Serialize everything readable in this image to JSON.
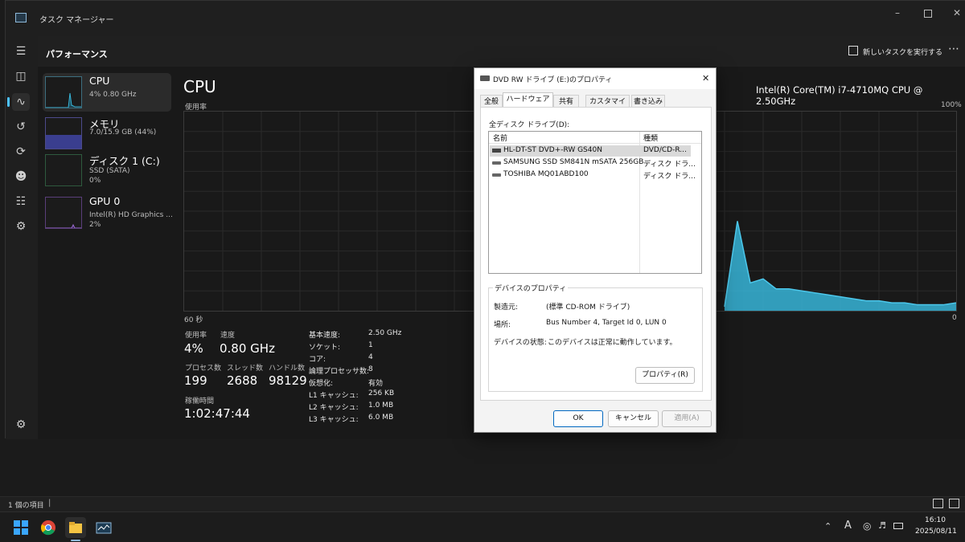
{
  "window": {
    "title": "タスク マネージャー",
    "page_title": "パフォーマンス",
    "run_task_label": "新しいタスクを実行する"
  },
  "sidebar": {
    "items": [
      {
        "title": "CPU",
        "sub1": "4% 0.80 GHz",
        "sub2": ""
      },
      {
        "title": "メモリ",
        "sub1": "7.0/15.9 GB (44%)",
        "sub2": ""
      },
      {
        "title": "ディスク 1 (C:)",
        "sub1": "SSD (SATA)",
        "sub2": "0%"
      },
      {
        "title": "GPU 0",
        "sub1": "Intel(R) HD Graphics ...",
        "sub2": "2%"
      }
    ]
  },
  "cpu": {
    "heading": "CPU",
    "model": "Intel(R) Core(TM) i7-4710MQ CPU @ 2.50GHz",
    "usage_label": "使用率",
    "max_label": "100%",
    "time_label": "60 秒",
    "zero_label": "0",
    "stats": {
      "usage_label": "使用率",
      "usage_value": "4%",
      "speed_label": "速度",
      "speed_value": "0.80 GHz",
      "proc_label": "プロセス数",
      "proc_value": "199",
      "thread_label": "スレッド数",
      "thread_value": "2688",
      "handle_label": "ハンドル数",
      "handle_value": "98129",
      "uptime_label": "稼働時間",
      "uptime_value": "1:02:47:44"
    },
    "specs": [
      {
        "label": "基本速度:",
        "value": "2.50 GHz"
      },
      {
        "label": "ソケット:",
        "value": "1"
      },
      {
        "label": "コア:",
        "value": "4"
      },
      {
        "label": "論理プロセッサ数:",
        "value": "8"
      },
      {
        "label": "仮想化:",
        "value": "有効"
      },
      {
        "label": "L1 キャッシュ:",
        "value": "256 KB"
      },
      {
        "label": "L2 キャッシュ:",
        "value": "1.0 MB"
      },
      {
        "label": "L3 キャッシュ:",
        "value": "6.0 MB"
      }
    ]
  },
  "dialog": {
    "title": "DVD RW ドライブ (E:)のプロパティ",
    "close": "✕",
    "tabs": [
      "全般",
      "ハードウェア",
      "共有",
      "カスタマイズ",
      "書き込み"
    ],
    "active_tab": 1,
    "list_label": "全ディスク ドライブ(D):",
    "col_name": "名前",
    "col_type": "種類",
    "drives": [
      {
        "name": "HL-DT-ST DVD+-RW GS40N",
        "type": "DVD/CD-R..."
      },
      {
        "name": "SAMSUNG SSD SM841N mSATA 256GB",
        "type": "ディスク ドラ..."
      },
      {
        "name": "TOSHIBA MQ01ABD100",
        "type": "ディスク ドラ..."
      }
    ],
    "props_group": "デバイスのプロパティ",
    "maker_label": "製造元:",
    "maker_value": "(標準 CD-ROM ドライブ)",
    "location_label": "場所:",
    "location_value": "Bus Number 4, Target Id 0, LUN 0",
    "status_label": "デバイスの状態:",
    "status_value": "このデバイスは正常に動作しています。",
    "properties_button": "プロパティ(R)",
    "ok": "OK",
    "cancel": "キャンセル",
    "apply": "適用(A)"
  },
  "explorer": {
    "item_count": "1 個の項目"
  },
  "taskbar": {
    "time": "16:10",
    "date": "2025/08/11",
    "ime": "A"
  },
  "chart_data": {
    "type": "area",
    "title": "CPU",
    "ylabel": "使用率",
    "xlabel": "60 秒",
    "ylim": [
      0,
      100
    ],
    "x": [
      0,
      2,
      4,
      6,
      8,
      10,
      12,
      14,
      16,
      18,
      20,
      22,
      24,
      26,
      28,
      30,
      32,
      34,
      36,
      38,
      40,
      42,
      44,
      46,
      48,
      50,
      52,
      54,
      56,
      58,
      60
    ],
    "values": [
      0,
      0,
      0,
      0,
      0,
      0,
      0,
      0,
      0,
      0,
      0,
      0,
      0,
      0,
      0,
      0,
      0,
      0,
      0,
      0,
      0,
      0,
      0,
      0,
      0,
      0,
      0,
      0,
      0,
      0,
      0
    ],
    "visible_tail": {
      "x": [
        42,
        43,
        44,
        45,
        46,
        47,
        48,
        49,
        50,
        51,
        52,
        53,
        54,
        55,
        56,
        57,
        58,
        59,
        60
      ],
      "values": [
        2,
        45,
        14,
        16,
        11,
        11,
        10,
        9,
        8,
        7,
        6,
        5,
        5,
        4,
        4,
        3,
        3,
        3,
        4
      ]
    },
    "color": "#37b5d8"
  }
}
